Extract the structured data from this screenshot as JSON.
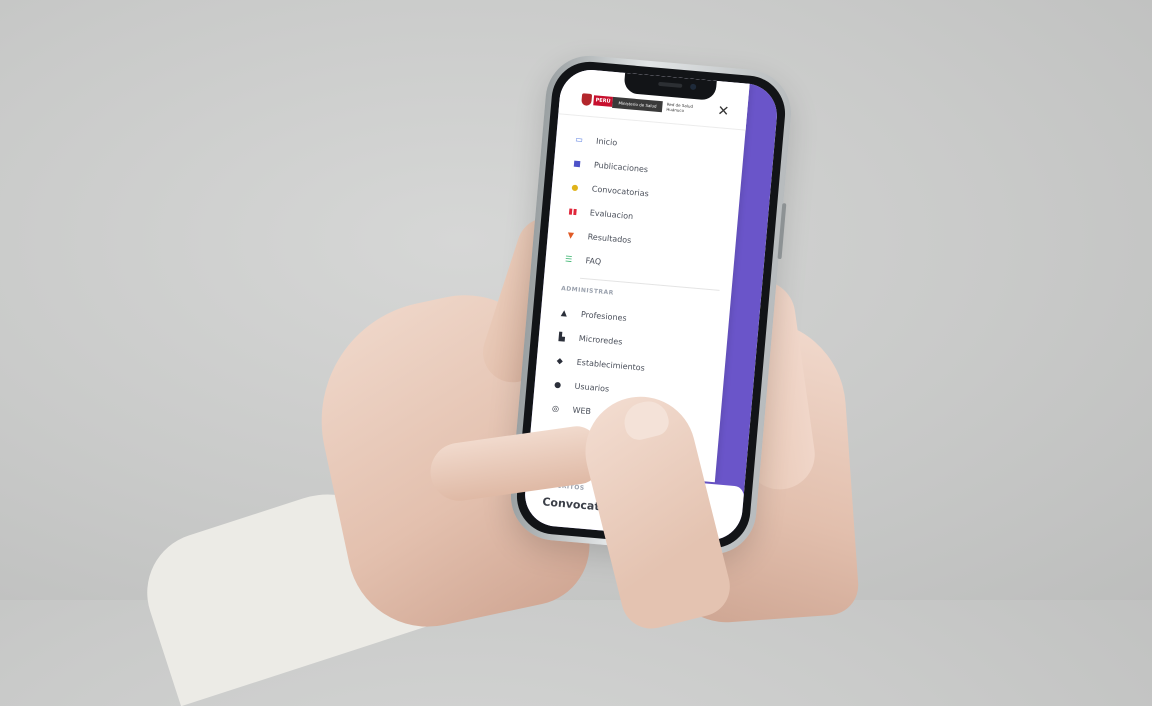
{
  "header": {
    "logo_country": "PERÚ",
    "logo_ministry": "Ministerio de Salud",
    "logo_network": "Red de Salud Huánuco",
    "close_symbol": "✕"
  },
  "menu": {
    "items": [
      {
        "label": "Inicio",
        "icon": "monitor-icon",
        "color": "#5b7fe0"
      },
      {
        "label": "Publicaciones",
        "icon": "documents-icon",
        "color": "#4d52c8"
      },
      {
        "label": "Convocatorias",
        "icon": "person-icon",
        "color": "#e0b31a"
      },
      {
        "label": "Evaluacion",
        "icon": "evaluation-icon",
        "color": "#e0263a"
      },
      {
        "label": "Resultados",
        "icon": "trophy-icon",
        "color": "#e05a26"
      },
      {
        "label": "FAQ",
        "icon": "list-icon",
        "color": "#36b36c"
      }
    ],
    "admin_section": "ADMINISTRAR",
    "admin_items": [
      {
        "label": "Profesiones",
        "icon": "graduation-cap-icon"
      },
      {
        "label": "Microredes",
        "icon": "buildings-icon"
      },
      {
        "label": "Establecimientos",
        "icon": "location-pin-icon"
      },
      {
        "label": "Usuarios",
        "icon": "user-circle-icon"
      },
      {
        "label": "WEB",
        "icon": "web-icon"
      }
    ]
  },
  "bottom": {
    "section": "INSCRITOS",
    "title": "Convocatorias"
  },
  "colors": {
    "accent": "#6a55c9"
  }
}
